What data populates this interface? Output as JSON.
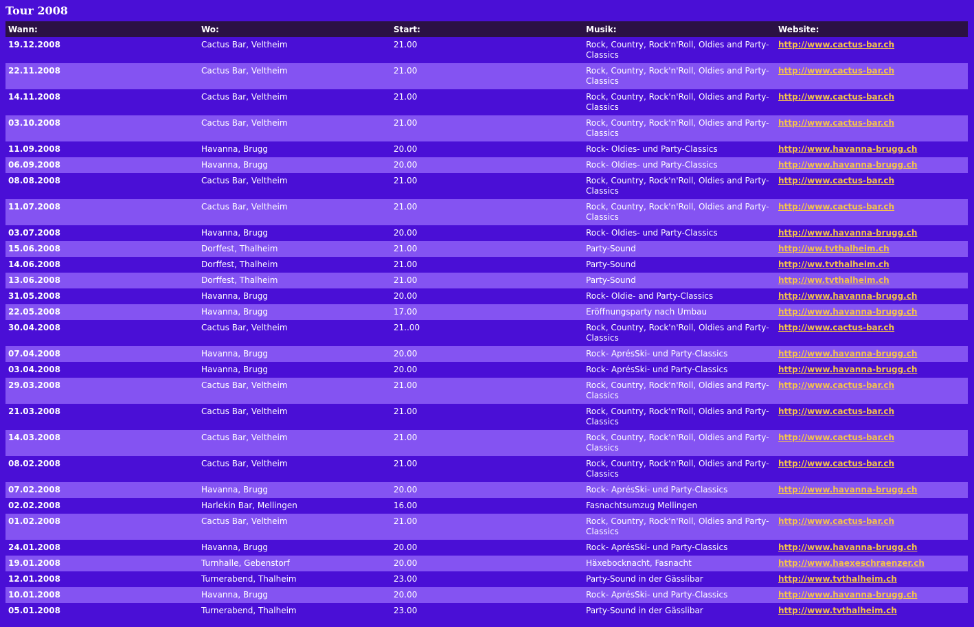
{
  "title": "Tour 2008",
  "columns": {
    "when": "Wann:",
    "where": "Wo:",
    "start": "Start:",
    "music": "Musik:",
    "website": "Website:"
  },
  "rows": [
    {
      "date": "19.12.2008",
      "venue": "Cactus Bar, Veltheim",
      "start": "21.00",
      "music": "Rock, Country, Rock'n'Roll, Oldies and Party-Classics",
      "url": "http://www.cactus-bar.ch"
    },
    {
      "date": "22.11.2008",
      "venue": "Cactus Bar, Veltheim",
      "start": "21.00",
      "music": "Rock, Country, Rock'n'Roll, Oldies and Party-Classics",
      "url": "http://www.cactus-bar.ch"
    },
    {
      "date": "14.11.2008",
      "venue": "Cactus Bar, Veltheim",
      "start": "21.00",
      "music": "Rock, Country, Rock'n'Roll, Oldies and Party-Classics",
      "url": "http://www.cactus-bar.ch"
    },
    {
      "date": "03.10.2008",
      "venue": "Cactus Bar, Veltheim",
      "start": "21.00",
      "music": "Rock, Country, Rock'n'Roll, Oldies and Party-Classics",
      "url": "http://www.cactus-bar.ch"
    },
    {
      "date": "11.09.2008",
      "venue": "Havanna, Brugg",
      "start": "20.00",
      "music": "Rock- Oldies- und Party-Classics",
      "url": "http://www.havanna-brugg.ch"
    },
    {
      "date": "06.09.2008",
      "venue": "Havanna, Brugg",
      "start": "20.00",
      "music": "Rock- Oldies- und Party-Classics",
      "url": "http://www.havanna-brugg.ch"
    },
    {
      "date": "08.08.2008",
      "venue": "Cactus Bar, Veltheim",
      "start": "21.00",
      "music": "Rock, Country, Rock'n'Roll, Oldies and Party-Classics",
      "url": "http://www.cactus-bar.ch"
    },
    {
      "date": "11.07.2008",
      "venue": "Cactus Bar, Veltheim",
      "start": "21.00",
      "music": "Rock, Country, Rock'n'Roll, Oldies and Party-Classics",
      "url": "http://www.cactus-bar.ch"
    },
    {
      "date": "03.07.2008",
      "venue": "Havanna, Brugg",
      "start": "20.00",
      "music": "Rock- Oldies- und Party-Classics",
      "url": "http://www.havanna-brugg.ch"
    },
    {
      "date": "15.06.2008",
      "venue": "Dorffest, Thalheim",
      "start": "21.00",
      "music": "Party-Sound",
      "url": "http://ww.tvthalheim.ch"
    },
    {
      "date": "14.06.2008",
      "venue": "Dorffest, Thalheim",
      "start": "21.00",
      "music": "Party-Sound",
      "url": "http://ww.tvthalheim.ch"
    },
    {
      "date": "13.06.2008",
      "venue": "Dorffest, Thalheim",
      "start": "21.00",
      "music": "Party-Sound",
      "url": "http://ww.tvthalheim.ch"
    },
    {
      "date": "31.05.2008",
      "venue": "Havanna, Brugg",
      "start": "20.00",
      "music": "Rock- Oldie- and Party-Classics",
      "url": "http://www.havanna-brugg.ch"
    },
    {
      "date": "22.05.2008",
      "venue": "Havanna, Brugg",
      "start": "17.00",
      "music": "Eröffnungsparty nach Umbau",
      "url": "http://www.havanna-brugg.ch"
    },
    {
      "date": "30.04.2008",
      "venue": "Cactus Bar, Veltheim",
      "start": "21..00",
      "music": "Rock, Country, Rock'n'Roll, Oldies and Party-Classics",
      "url": "http://www.cactus-bar.ch"
    },
    {
      "date": "07.04.2008",
      "venue": "Havanna, Brugg",
      "start": "20.00",
      "music": "Rock- AprésSki- und Party-Classics",
      "url": "http://www.havanna-brugg.ch"
    },
    {
      "date": "03.04.2008",
      "venue": "Havanna, Brugg",
      "start": "20.00",
      "music": "Rock- AprésSki- und Party-Classics",
      "url": "http://www.havanna-brugg.ch"
    },
    {
      "date": "29.03.2008",
      "venue": "Cactus Bar, Veltheim",
      "start": "21.00",
      "music": "Rock, Country, Rock'n'Roll, Oldies and Party-Classics",
      "url": "http://www.cactus-bar.ch"
    },
    {
      "date": "21.03.2008",
      "venue": "Cactus Bar, Veltheim",
      "start": "21.00",
      "music": "Rock, Country, Rock'n'Roll, Oldies and Party-Classics",
      "url": "http://www.cactus-bar.ch"
    },
    {
      "date": "14.03.2008",
      "venue": "Cactus Bar, Veltheim",
      "start": "21.00",
      "music": "Rock, Country, Rock'n'Roll, Oldies and Party-Classics",
      "url": "http://www.cactus-bar.ch"
    },
    {
      "date": "08.02.2008",
      "venue": "Cactus Bar, Veltheim",
      "start": "21.00",
      "music": "Rock, Country, Rock'n'Roll, Oldies and Party-Classics",
      "url": "http://www.cactus-bar.ch"
    },
    {
      "date": "07.02.2008",
      "venue": "Havanna, Brugg",
      "start": "20.00",
      "music": "Rock- AprésSki- und Party-Classics",
      "url": "http://www.havanna-brugg.ch"
    },
    {
      "date": "02.02.2008",
      "venue": "Harlekin Bar, Mellingen",
      "start": "16.00",
      "music": "Fasnachtsumzug Mellingen",
      "url": ""
    },
    {
      "date": "01.02.2008",
      "venue": "Cactus Bar, Veltheim",
      "start": "21.00",
      "music": "Rock, Country, Rock'n'Roll, Oldies and Party-Classics",
      "url": "http://www.cactus-bar.ch"
    },
    {
      "date": "24.01.2008",
      "venue": "Havanna, Brugg",
      "start": "20.00",
      "music": "Rock- AprésSki- und Party-Classics",
      "url": "http://www.havanna-brugg.ch"
    },
    {
      "date": "19.01.2008",
      "venue": "Turnhalle, Gebenstorf",
      "start": "20.00",
      "music": "Häxebocknacht, Fasnacht",
      "url": "http://www.haexeschraenzer.ch"
    },
    {
      "date": "12.01.2008",
      "venue": "Turnerabend, Thalheim",
      "start": "23.00",
      "music": "Party-Sound in der Gässlibar",
      "url": "http://www.tvthalheim.ch"
    },
    {
      "date": "10.01.2008",
      "venue": "Havanna, Brugg",
      "start": "20.00",
      "music": "Rock- AprésSki- und Party-Classics",
      "url": "http://www.havanna-brugg.ch"
    },
    {
      "date": "05.01.2008",
      "venue": "Turnerabend, Thalheim",
      "start": "23.00",
      "music": "Party-Sound in der Gässlibar",
      "url": "http://www.tvthalheim.ch"
    }
  ],
  "colors": {
    "background": "#4a0fd6",
    "row_alt": "#8453f2",
    "header": "#2b1144",
    "link": "#f4c24c"
  }
}
